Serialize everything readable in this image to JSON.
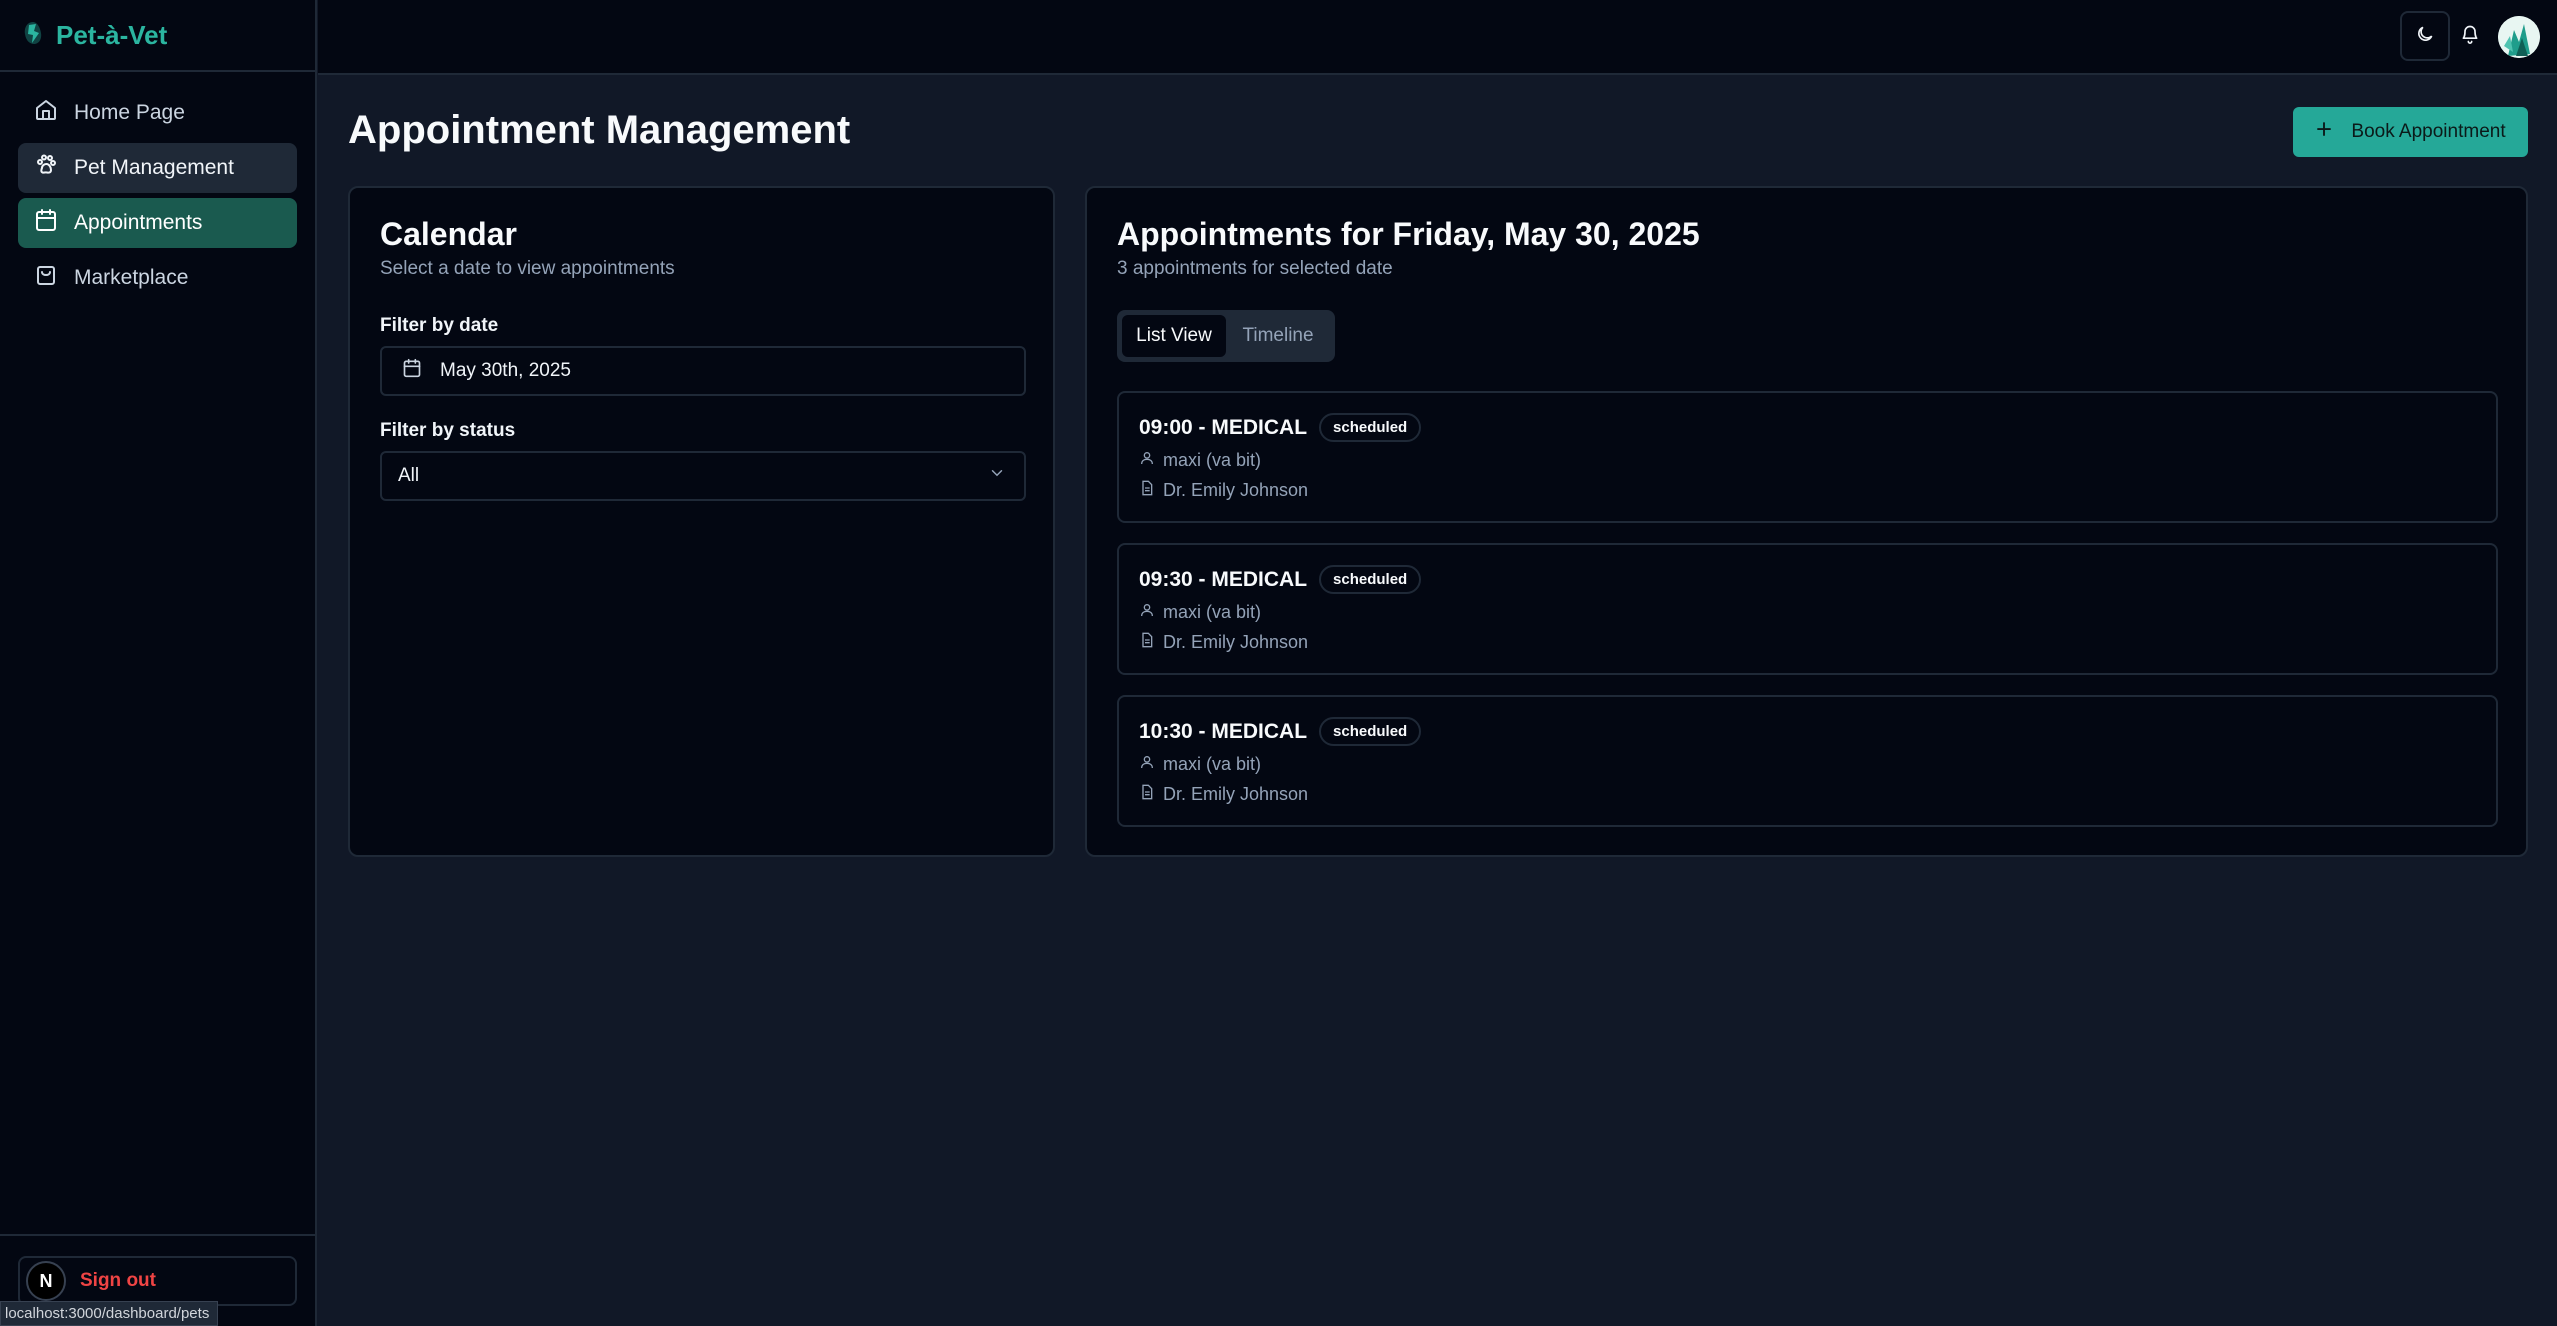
{
  "brand": {
    "name": "Pet-à-Vet"
  },
  "sidebar": {
    "items": [
      {
        "label": "Home Page",
        "icon": "home-icon"
      },
      {
        "label": "Pet Management",
        "icon": "paw-icon"
      },
      {
        "label": "Appointments",
        "icon": "calendar-icon"
      },
      {
        "label": "Marketplace",
        "icon": "shopping-bag-icon"
      }
    ],
    "footer": {
      "avatar_letter": "N",
      "signout_label": "Sign out"
    },
    "status_url": "localhost:3000/dashboard/pets"
  },
  "topbar": {
    "theme_icon": "moon-icon",
    "notification_icon": "bell-icon"
  },
  "page": {
    "title": "Appointment Management",
    "book_button": "Book Appointment"
  },
  "calendar": {
    "title": "Calendar",
    "subtitle": "Select a date to view appointments",
    "date_label": "Filter by date",
    "date_value": "May 30th, 2025",
    "status_label": "Filter by status",
    "status_value": "All"
  },
  "appointments": {
    "title": "Appointments for Friday, May 30, 2025",
    "subtitle": "3 appointments for selected date",
    "tabs": [
      "List View",
      "Timeline"
    ],
    "items": [
      {
        "title": "09:00 - MEDICAL",
        "status": "scheduled",
        "pet": "maxi (va bit)",
        "vet": "Dr. Emily Johnson"
      },
      {
        "title": "09:30 - MEDICAL",
        "status": "scheduled",
        "pet": "maxi (va bit)",
        "vet": "Dr. Emily Johnson"
      },
      {
        "title": "10:30 - MEDICAL",
        "status": "scheduled",
        "pet": "maxi (va bit)",
        "vet": "Dr. Emily Johnson"
      }
    ]
  },
  "colors": {
    "accent": "#25a898",
    "brand_text": "#2bb5a0",
    "active_nav": "#1a5a4f",
    "signout": "#ef4444",
    "background": "#111827",
    "panel": "#030712"
  }
}
